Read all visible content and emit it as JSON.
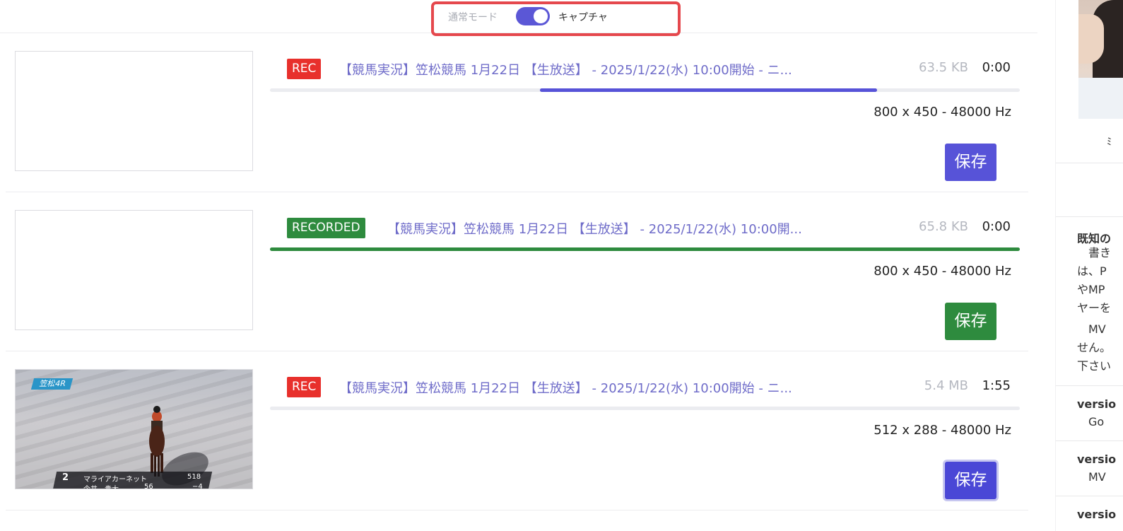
{
  "mode_toggle": {
    "off_label": "通常モード",
    "on_label": "キャプチャ",
    "enabled": true
  },
  "colors": {
    "accent": "#5753d8",
    "rec": "#e8302c",
    "recorded": "#2e8b3e",
    "title_link": "#6f6cc9",
    "highlight_box": "#e5484d"
  },
  "recordings": [
    {
      "status": "REC",
      "title": "【競馬実況】笠松競馬 1月22日 【生放送】 - 2025/1/22(水) 10:00開始 - ニ...",
      "size": "63.5 KB",
      "duration": "0:00",
      "resolution": "800 x 450 - 48000 Hz",
      "save_label": "保存",
      "progress_start": 0.36,
      "progress_end": 0.81
    },
    {
      "status": "RECORDED",
      "title": "【競馬実況】笠松競馬 1月22日 【生放送】 - 2025/1/22(水) 10:00開...",
      "size": "65.8 KB",
      "duration": "0:00",
      "resolution": "800 x 450 - 48000 Hz",
      "save_label": "保存",
      "progress_start": 0,
      "progress_end": 1
    },
    {
      "status": "REC",
      "title": "【競馬実況】笠松競馬 1月22日 【生放送】 - 2025/1/22(水) 10:00開始 - ニ...",
      "size": "5.4 MB",
      "duration": "1:55",
      "resolution": "512 x 288 - 48000 Hz",
      "save_label": "保存",
      "progress_start": 0,
      "progress_end": 0,
      "thumbnail": {
        "race_label": "笠松4R",
        "horse_number": "2",
        "horse_name": "マライアカーネット",
        "jockey": "今井　貴大",
        "weight": "56",
        "stat_1": "518",
        "stat_2": "−4"
      }
    }
  ],
  "sidebar": {
    "dot_char": "ﾐ",
    "sections": [
      {
        "heading": "既知の",
        "lines": [
          "　書き",
          "は、P",
          "やMP",
          "ヤーを",
          "　MV",
          "せん。",
          "下さい"
        ]
      },
      {
        "heading": "versio",
        "lines": [
          "　Go"
        ]
      },
      {
        "heading": "versio",
        "lines": [
          "　MV"
        ]
      },
      {
        "heading": "versio",
        "lines": []
      }
    ]
  }
}
